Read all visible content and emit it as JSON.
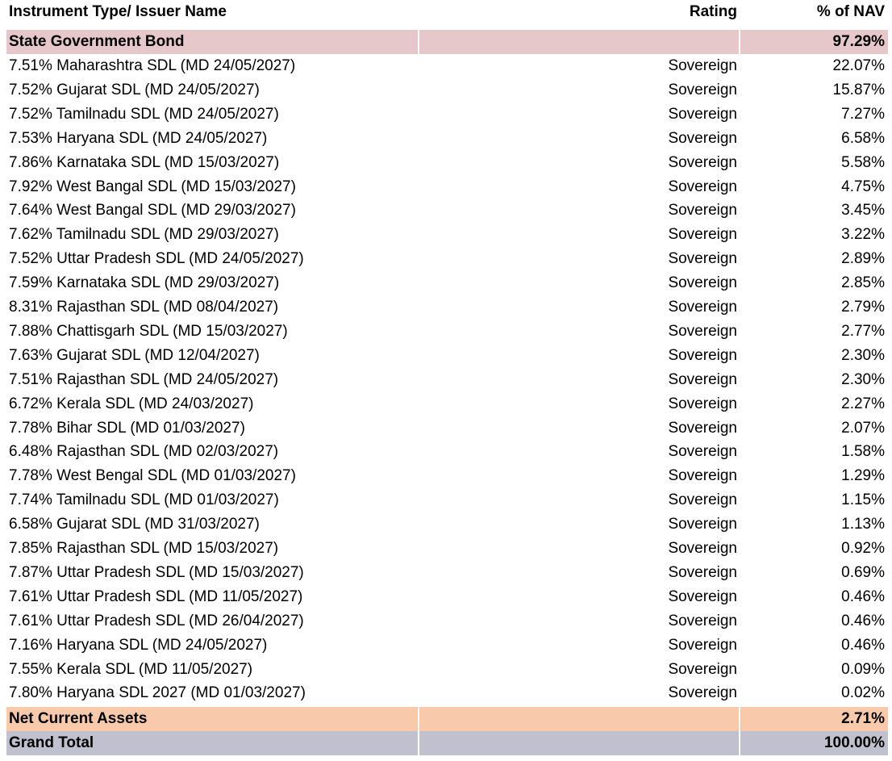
{
  "header": {
    "name": "Instrument Type/ Issuer Name",
    "rating": "Rating",
    "nav": "% of NAV"
  },
  "section": {
    "label": "State Government Bond",
    "nav": "97.29%",
    "color": "#e6c8cb"
  },
  "holdings": [
    {
      "name": "7.51% Maharashtra SDL (MD 24/05/2027)",
      "rating": "Sovereign",
      "nav": "22.07%"
    },
    {
      "name": "7.52% Gujarat SDL (MD 24/05/2027)",
      "rating": "Sovereign",
      "nav": "15.87%"
    },
    {
      "name": "7.52% Tamilnadu SDL (MD 24/05/2027)",
      "rating": "Sovereign",
      "nav": "7.27%"
    },
    {
      "name": "7.53% Haryana SDL (MD 24/05/2027)",
      "rating": "Sovereign",
      "nav": "6.58%"
    },
    {
      "name": "7.86% Karnataka SDL (MD 15/03/2027)",
      "rating": "Sovereign",
      "nav": "5.58%"
    },
    {
      "name": "7.92% West Bangal SDL (MD 15/03/2027)",
      "rating": "Sovereign",
      "nav": "4.75%"
    },
    {
      "name": "7.64% West Bangal SDL (MD 29/03/2027)",
      "rating": "Sovereign",
      "nav": "3.45%"
    },
    {
      "name": "7.62% Tamilnadu SDL (MD 29/03/2027)",
      "rating": "Sovereign",
      "nav": "3.22%"
    },
    {
      "name": "7.52% Uttar Pradesh SDL (MD 24/05/2027)",
      "rating": "Sovereign",
      "nav": "2.89%"
    },
    {
      "name": "7.59% Karnataka SDL (MD 29/03/2027)",
      "rating": "Sovereign",
      "nav": "2.85%"
    },
    {
      "name": "8.31% Rajasthan SDL (MD 08/04/2027)",
      "rating": "Sovereign",
      "nav": "2.79%"
    },
    {
      "name": "7.88% Chattisgarh SDL (MD 15/03/2027)",
      "rating": "Sovereign",
      "nav": "2.77%"
    },
    {
      "name": "7.63% Gujarat SDL (MD 12/04/2027)",
      "rating": "Sovereign",
      "nav": "2.30%"
    },
    {
      "name": "7.51% Rajasthan SDL (MD 24/05/2027)",
      "rating": "Sovereign",
      "nav": "2.30%"
    },
    {
      "name": "6.72% Kerala SDL (MD 24/03/2027)",
      "rating": "Sovereign",
      "nav": "2.27%"
    },
    {
      "name": "7.78% Bihar SDL (MD 01/03/2027)",
      "rating": "Sovereign",
      "nav": "2.07%"
    },
    {
      "name": "6.48% Rajasthan SDL (MD 02/03/2027)",
      "rating": "Sovereign",
      "nav": "1.58%"
    },
    {
      "name": "7.78% West Bengal SDL (MD 01/03/2027)",
      "rating": "Sovereign",
      "nav": "1.29%"
    },
    {
      "name": "7.74% Tamilnadu SDL (MD 01/03/2027)",
      "rating": "Sovereign",
      "nav": "1.15%"
    },
    {
      "name": "6.58% Gujarat SDL (MD 31/03/2027)",
      "rating": "Sovereign",
      "nav": "1.13%"
    },
    {
      "name": "7.85% Rajasthan SDL (MD 15/03/2027)",
      "rating": "Sovereign",
      "nav": "0.92%"
    },
    {
      "name": "7.87% Uttar Pradesh SDL (MD 15/03/2027)",
      "rating": "Sovereign",
      "nav": "0.69%"
    },
    {
      "name": "7.61% Uttar Pradesh SDL (MD 11/05/2027)",
      "rating": "Sovereign",
      "nav": "0.46%"
    },
    {
      "name": "7.61% Uttar Pradesh SDL (MD 26/04/2027)",
      "rating": "Sovereign",
      "nav": "0.46%"
    },
    {
      "name": "7.16% Haryana SDL (MD 24/05/2027)",
      "rating": "Sovereign",
      "nav": "0.46%"
    },
    {
      "name": "7.55% Kerala SDL (MD 11/05/2027)",
      "rating": "Sovereign",
      "nav": "0.09%"
    },
    {
      "name": "7.80% Haryana SDL 2027 (MD 01/03/2027)",
      "rating": "Sovereign",
      "nav": "0.02%"
    }
  ],
  "net_current_assets": {
    "label": "Net Current Assets",
    "nav": "2.71%",
    "color": "#f9c9ab"
  },
  "grand_total": {
    "label": "Grand Total",
    "nav": "100.00%",
    "color": "#c0c0cf"
  }
}
